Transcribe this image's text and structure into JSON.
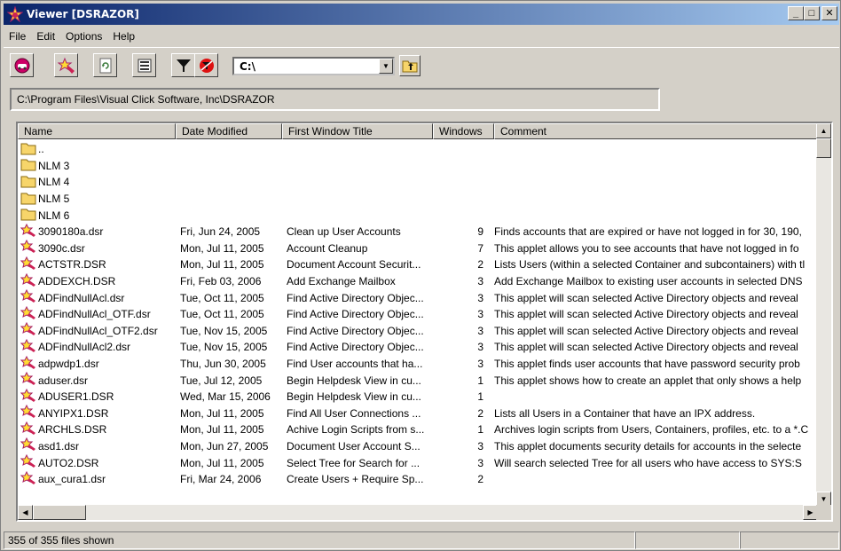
{
  "window": {
    "title": "Viewer [DSRAZOR]",
    "minimize_glyph": "_",
    "maximize_glyph": "□",
    "close_glyph": "✕"
  },
  "menu": [
    {
      "label": "File"
    },
    {
      "label": "Edit"
    },
    {
      "label": "Options"
    },
    {
      "label": "Help"
    }
  ],
  "toolbar": {
    "buttons": [
      {
        "icon": "dsrazor-run-icon"
      },
      {
        "icon": "applet-star-icon"
      },
      {
        "icon": "refresh-page-icon"
      },
      {
        "icon": "list-view-icon"
      },
      {
        "icon": "filter-funnel-icon"
      },
      {
        "icon": "no-filter-icon"
      }
    ],
    "drive": {
      "value": "C:\\"
    }
  },
  "path": "C:\\Program Files\\Visual Click Software, Inc\\DSRAZOR",
  "columns": [
    "Name",
    "Date Modified",
    "First Window Title",
    "Windows",
    "Comment"
  ],
  "rows": [
    {
      "type": "folder",
      "name": "..",
      "date": "",
      "title": "",
      "windows": "",
      "comment": ""
    },
    {
      "type": "folder",
      "name": "NLM 3",
      "date": "",
      "title": "",
      "windows": "",
      "comment": ""
    },
    {
      "type": "folder",
      "name": "NLM 4",
      "date": "",
      "title": "",
      "windows": "",
      "comment": ""
    },
    {
      "type": "folder",
      "name": "NLM 5",
      "date": "",
      "title": "",
      "windows": "",
      "comment": ""
    },
    {
      "type": "folder",
      "name": "NLM 6",
      "date": "",
      "title": "",
      "windows": "",
      "comment": ""
    },
    {
      "type": "applet",
      "name": "3090180a.dsr",
      "date": "Fri, Jun 24, 2005",
      "title": "Clean up User Accounts",
      "windows": "9",
      "comment": "Finds accounts that are expired or have not logged in for 30, 190,"
    },
    {
      "type": "applet",
      "name": "3090c.dsr",
      "date": "Mon, Jul 11, 2005",
      "title": "Account Cleanup",
      "windows": "7",
      "comment": "This applet allows you to see accounts that have not logged in fo"
    },
    {
      "type": "applet",
      "name": "ACTSTR.DSR",
      "date": "Mon, Jul 11, 2005",
      "title": "Document Account Securit...",
      "windows": "2",
      "comment": "Lists Users (within a selected Container and subcontainers) with tl"
    },
    {
      "type": "applet",
      "name": "ADDEXCH.DSR",
      "date": "Fri, Feb 03, 2006",
      "title": "Add Exchange Mailbox",
      "windows": "3",
      "comment": "Add Exchange Mailbox to existing user accounts in selected DNS"
    },
    {
      "type": "applet",
      "name": "ADFindNullAcl.dsr",
      "date": "Tue, Oct 11, 2005",
      "title": "Find Active Directory Objec...",
      "windows": "3",
      "comment": "This applet will scan selected Active Directory objects and reveal"
    },
    {
      "type": "applet",
      "name": "ADFindNullAcl_OTF.dsr",
      "date": "Tue, Oct 11, 2005",
      "title": "Find Active Directory Objec...",
      "windows": "3",
      "comment": "This applet will scan selected Active Directory objects and reveal"
    },
    {
      "type": "applet",
      "name": "ADFindNullAcl_OTF2.dsr",
      "date": "Tue, Nov 15, 2005",
      "title": "Find Active Directory Objec...",
      "windows": "3",
      "comment": "This applet will scan selected Active Directory objects and reveal"
    },
    {
      "type": "applet",
      "name": "ADFindNullAcl2.dsr",
      "date": "Tue, Nov 15, 2005",
      "title": "Find Active Directory Objec...",
      "windows": "3",
      "comment": "This applet will scan selected Active Directory objects and reveal"
    },
    {
      "type": "applet",
      "name": "adpwdp1.dsr",
      "date": "Thu, Jun 30, 2005",
      "title": "Find User accounts that ha...",
      "windows": "3",
      "comment": "This applet finds user accounts that have password security prob"
    },
    {
      "type": "applet",
      "name": "aduser.dsr",
      "date": "Tue, Jul 12, 2005",
      "title": "Begin Helpdesk View in cu...",
      "windows": "1",
      "comment": "This applet shows how to create an applet that only shows a help"
    },
    {
      "type": "applet",
      "name": "ADUSER1.DSR",
      "date": "Wed, Mar 15, 2006",
      "title": "Begin Helpdesk View in cu...",
      "windows": "1",
      "comment": ""
    },
    {
      "type": "applet",
      "name": "ANYIPX1.DSR",
      "date": "Mon, Jul 11, 2005",
      "title": "Find All User Connections ...",
      "windows": "2",
      "comment": "Lists all Users in a Container that have an IPX address."
    },
    {
      "type": "applet",
      "name": "ARCHLS.DSR",
      "date": "Mon, Jul 11, 2005",
      "title": "Achive Login Scripts from s...",
      "windows": "1",
      "comment": "Archives login scripts from Users, Containers, profiles, etc. to a *.C"
    },
    {
      "type": "applet",
      "name": "asd1.dsr",
      "date": "Mon, Jun 27, 2005",
      "title": "Document User Account S...",
      "windows": "3",
      "comment": "This applet documents security details for accounts in the selecte"
    },
    {
      "type": "applet",
      "name": "AUTO2.DSR",
      "date": "Mon, Jul 11, 2005",
      "title": "Select Tree for Search for ...",
      "windows": "3",
      "comment": "Will search selected Tree for all users who have access to SYS:S"
    },
    {
      "type": "applet",
      "name": "aux_cura1.dsr",
      "date": "Fri, Mar 24, 2006",
      "title": "Create Users + Require Sp...",
      "windows": "2",
      "comment": ""
    }
  ],
  "status": {
    "files_shown": "355 of 355 files shown"
  },
  "colors": {
    "title_start": "#0a246a",
    "title_end": "#a6caf0",
    "face": "#d4d0c8",
    "folder": "#f7d56a",
    "applet": "#cc2255"
  }
}
